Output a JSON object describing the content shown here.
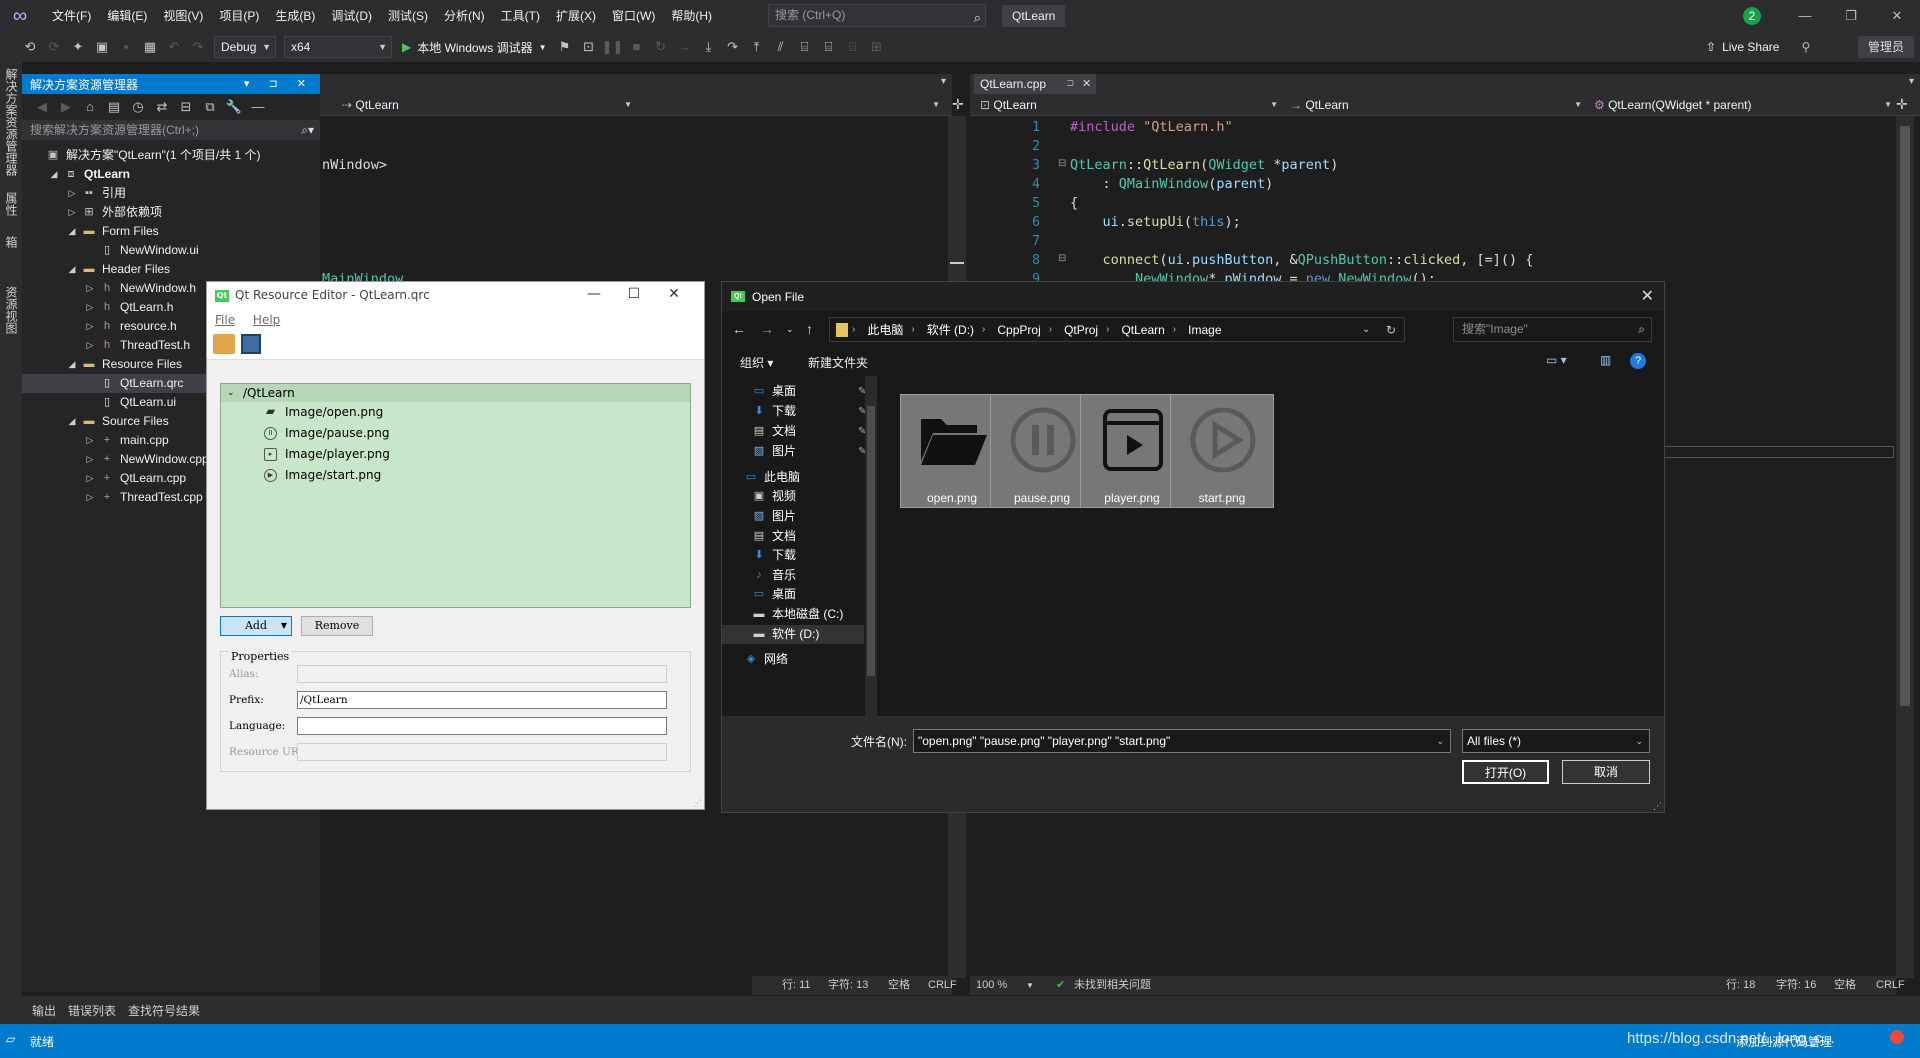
{
  "titlebar": {
    "menu": [
      "文件(F)",
      "编辑(E)",
      "视图(V)",
      "项目(P)",
      "生成(B)",
      "调试(D)",
      "测试(S)",
      "分析(N)",
      "工具(T)",
      "扩展(X)",
      "窗口(W)",
      "帮助(H)"
    ],
    "search_placeholder": "搜索 (Ctrl+Q)",
    "solution_name": "QtLearn",
    "notification_count": "2"
  },
  "toolbar": {
    "config": "Debug",
    "platform": "x64",
    "run_label": "本地 Windows 调试器",
    "live_share": "Live Share",
    "admin": "管理员"
  },
  "vertical_tabs": [
    "解决方案资源管理器",
    "属性",
    "工具箱",
    "资源视图"
  ],
  "solution_explorer": {
    "title": "解决方案资源管理器",
    "search_placeholder": "搜索解决方案资源管理器(Ctrl+;)",
    "tree": [
      {
        "label": "解决方案\"QtLearn\"(1 个项目/共 1 个)",
        "icon": "solution-icon"
      },
      {
        "label": "QtLearn",
        "icon": "project-icon"
      },
      {
        "label": "引用",
        "icon": "references-icon"
      },
      {
        "label": "外部依赖项",
        "icon": "external-deps-icon"
      },
      {
        "label": "Form Files",
        "icon": "folder-icon"
      },
      {
        "label": "NewWindow.ui",
        "icon": "ui-file-icon"
      },
      {
        "label": "Header Files",
        "icon": "folder-icon"
      },
      {
        "label": "NewWindow.h",
        "icon": "header-file-icon"
      },
      {
        "label": "QtLearn.h",
        "icon": "header-file-icon"
      },
      {
        "label": "resource.h",
        "icon": "header-file-icon"
      },
      {
        "label": "ThreadTest.h",
        "icon": "header-file-icon"
      },
      {
        "label": "Resource Files",
        "icon": "folder-icon"
      },
      {
        "label": "QtLearn.qrc",
        "icon": "qrc-file-icon"
      },
      {
        "label": "QtLearn.ui",
        "icon": "ui-file-icon"
      },
      {
        "label": "Source Files",
        "icon": "folder-icon"
      },
      {
        "label": "main.cpp",
        "icon": "cpp-file-icon"
      },
      {
        "label": "NewWindow.cpp",
        "icon": "cpp-file-icon"
      },
      {
        "label": "QtLearn.cpp",
        "icon": "cpp-file-icon"
      },
      {
        "label": "ThreadTest.cpp",
        "icon": "cpp-file-icon"
      }
    ]
  },
  "left_editor": {
    "nav_scope": "QtLearn",
    "code_fragments": [
      "nWindow>",
      "MainWindow"
    ],
    "status": {
      "line": "行: 11",
      "char": "字符: 13",
      "ws": "空格",
      "eol": "CRLF"
    }
  },
  "right_editor": {
    "tab": "QtLearn.cpp",
    "nav": [
      "QtLearn",
      "QtLearn",
      "QtLearn(QWidget * parent)"
    ],
    "line_numbers": [
      "1",
      "2",
      "3",
      "4",
      "5",
      "6",
      "7",
      "8",
      "9"
    ],
    "status": {
      "zoom": "100 %",
      "issues": "未找到相关问题",
      "line": "行: 18",
      "char": "字符: 16",
      "ws": "空格",
      "eol": "CRLF"
    }
  },
  "qt_resource_editor": {
    "title": "Qt Resource Editor - QtLearn.qrc",
    "menu": [
      "File",
      "Help"
    ],
    "prefix_root": "/QtLearn",
    "files": [
      "Image/open.png",
      "Image/pause.png",
      "Image/player.png",
      "Image/start.png"
    ],
    "add_label": "Add",
    "remove_label": "Remove",
    "properties_title": "Properties",
    "alias_label": "Alias:",
    "prefix_label": "Prefix:",
    "prefix_value": "/QtLearn",
    "language_label": "Language:",
    "url_label": "Resource URL:"
  },
  "open_file": {
    "title": "Open File",
    "breadcrumbs": [
      "此电脑",
      "软件 (D:)",
      "CppProj",
      "QtProj",
      "QtLearn",
      "Image"
    ],
    "search_placeholder": "搜索\"Image\"",
    "organize": "组织",
    "new_folder": "新建文件夹",
    "nav": [
      "桌面",
      "下载",
      "文档",
      "图片",
      "此电脑",
      "视频",
      "图片",
      "文档",
      "下载",
      "音乐",
      "桌面",
      "本地磁盘 (C:)",
      "软件 (D:)",
      "网络"
    ],
    "files": [
      "open.png",
      "pause.png",
      "player.png",
      "start.png"
    ],
    "filename_label": "文件名(N):",
    "filename_value": "\"open.png\" \"pause.png\" \"player.png\" \"start.png\"",
    "filter": "All files  (*)",
    "open_label": "打开(O)",
    "cancel_label": "取消"
  },
  "bottom_tabs": [
    "输出",
    "错误列表",
    "查找符号结果"
  ],
  "statusbar": {
    "ready": "就绪",
    "publish": "添加到源代码管理",
    "watermark": "https://blog.csdn.net/...long_c..."
  }
}
